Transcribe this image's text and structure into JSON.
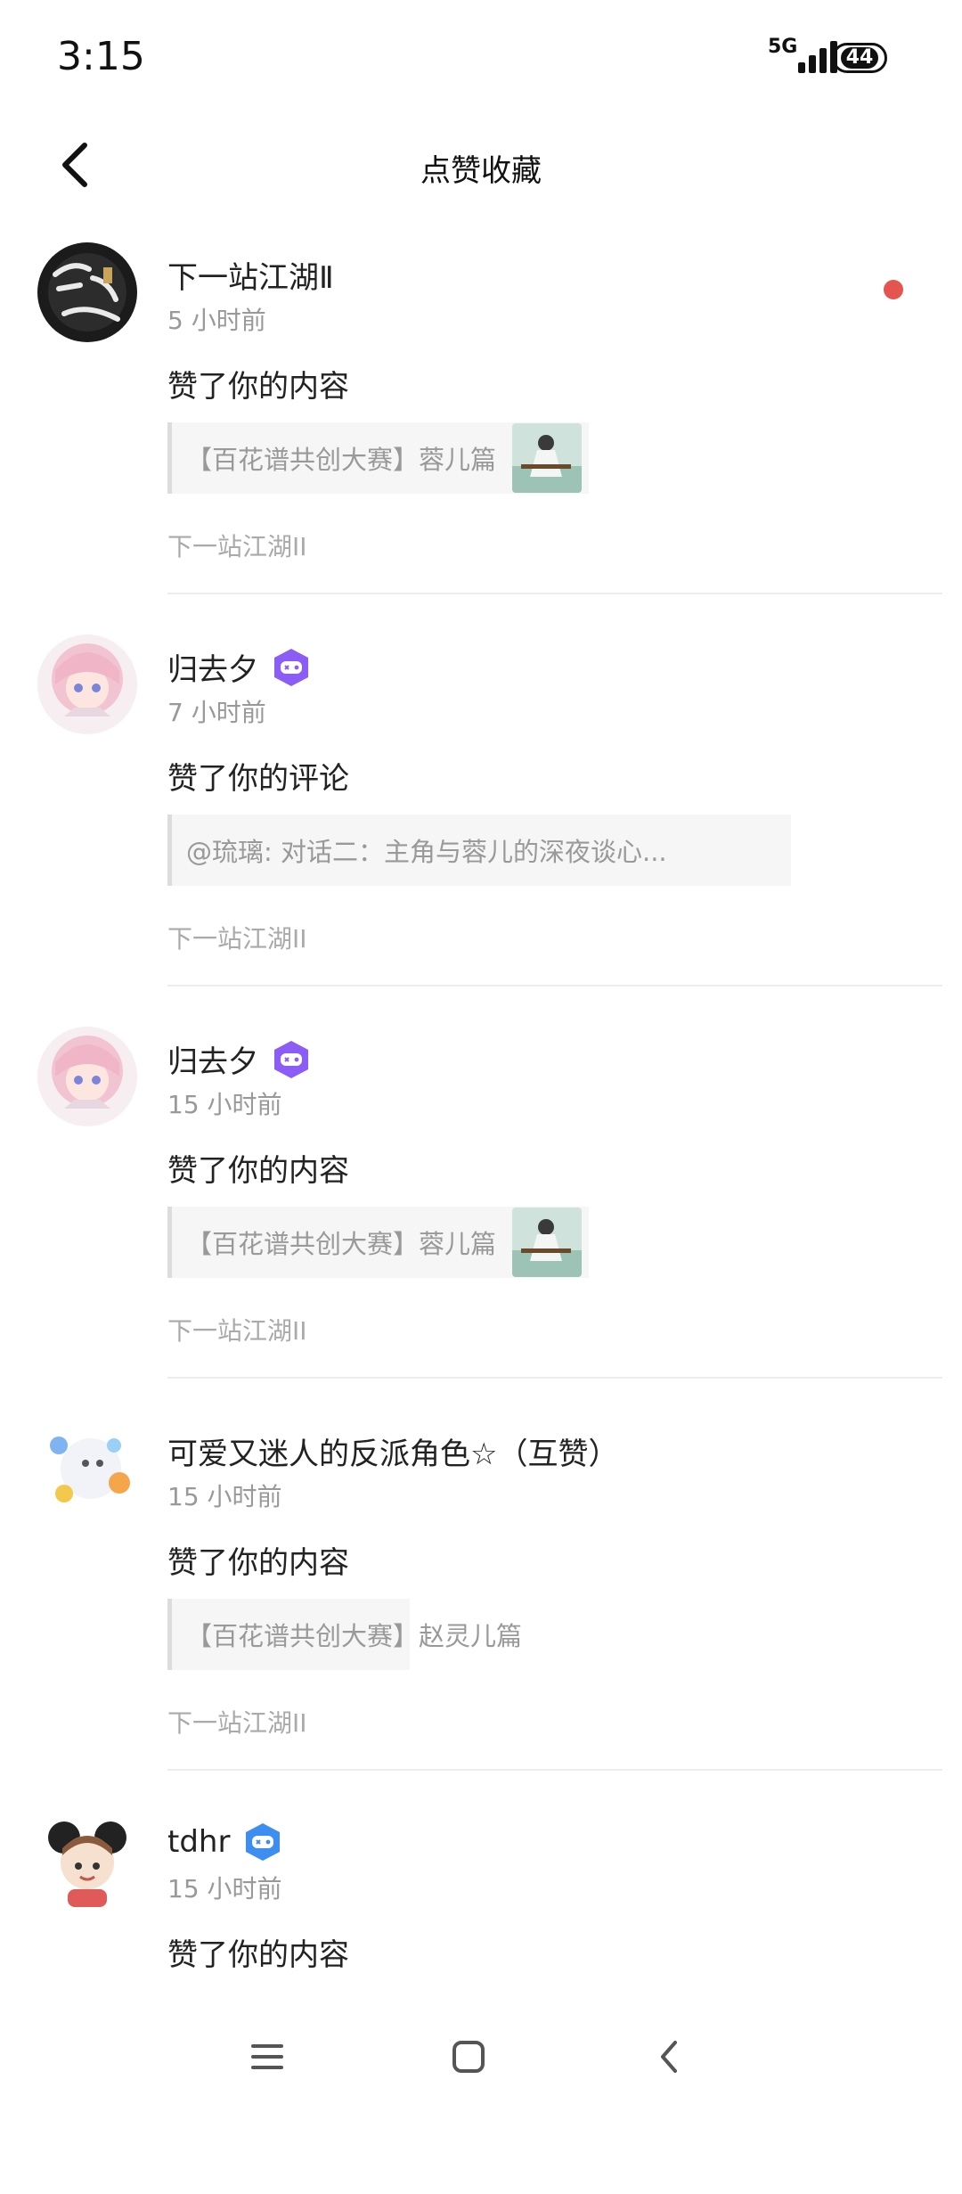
{
  "status_bar": {
    "time": "3:15",
    "network": "5G",
    "battery": "44"
  },
  "header": {
    "title": "点赞收藏",
    "back_icon": "chevron-left-icon"
  },
  "items": [
    {
      "name": "下一站江湖Ⅱ",
      "time": "5 小时前",
      "action": "赞了你的内容",
      "quote": "【百花谱共创大赛】蓉儿篇",
      "has_thumb": true,
      "source": "下一站江湖II",
      "unread": true,
      "badge": ""
    },
    {
      "name": "归去夕",
      "time": "7 小时前",
      "action": "赞了你的评论",
      "quote": "@琉璃: 对话二：主角与蓉儿的深夜谈心...",
      "has_thumb": false,
      "source": "下一站江湖II",
      "badge": "purple-gamepad-badge"
    },
    {
      "name": "归去夕",
      "time": "15 小时前",
      "action": "赞了你的内容",
      "quote": "【百花谱共创大赛】蓉儿篇",
      "has_thumb": true,
      "source": "下一站江湖II",
      "badge": "purple-gamepad-badge"
    },
    {
      "name": "可爱又迷人的反派角色☆（互赞）",
      "time": "15 小时前",
      "action": "赞了你的内容",
      "quote": "【百花谱共创大赛】赵灵儿篇",
      "has_thumb": false,
      "source": "下一站江湖II",
      "badge": ""
    },
    {
      "name": "tdhr",
      "time": "15 小时前",
      "action": "赞了你的内容",
      "badge": "blue-gamepad-badge"
    }
  ],
  "colors": {
    "unread_dot": "#e5554f",
    "badge_purple": "#8b5cf6",
    "badge_blue": "#3d8ef0"
  },
  "nav": {
    "menu_icon": "menu-icon",
    "home_icon": "home-square-icon",
    "back_icon": "back-triangle-icon"
  }
}
